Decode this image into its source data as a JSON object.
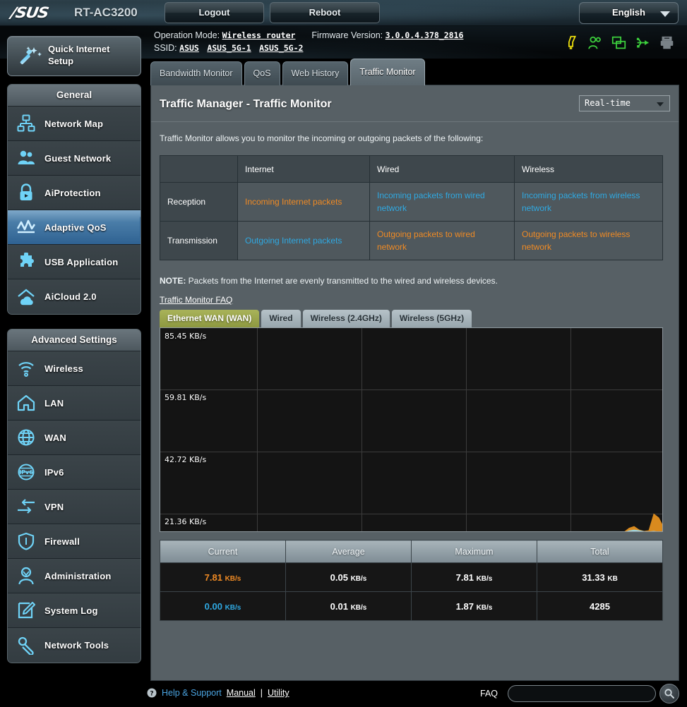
{
  "header": {
    "brand": "/SUS",
    "model": "RT-AC3200",
    "logout_label": "Logout",
    "reboot_label": "Reboot",
    "language": "English"
  },
  "info": {
    "operation_mode_label": "Operation Mode:",
    "operation_mode_value": "Wireless router",
    "firmware_label": "Firmware Version:",
    "firmware_value": "3.0.0.4.378_2816",
    "ssid_label": "SSID:",
    "ssid_values": [
      "ASUS",
      "ASUS_5G-1",
      "ASUS_5G-2"
    ],
    "status_icons": [
      {
        "name": "alert-icon",
        "color": "#f2e30c"
      },
      {
        "name": "guest-user-icon",
        "color": "#3dd13d"
      },
      {
        "name": "network-clients-icon",
        "color": "#3dd13d"
      },
      {
        "name": "usb-icon",
        "color": "#3dd13d"
      },
      {
        "name": "printer-icon",
        "color": "#7a8288"
      }
    ]
  },
  "tabs": [
    {
      "label": "Bandwidth Monitor",
      "active": false
    },
    {
      "label": "QoS",
      "active": false
    },
    {
      "label": "Web History",
      "active": false
    },
    {
      "label": "Traffic Monitor",
      "active": true
    }
  ],
  "sidebar": {
    "quick_setup": "Quick Internet Setup",
    "groups": [
      {
        "title": "General",
        "items": [
          {
            "label": "Network Map",
            "icon": "network-map-icon",
            "active": false
          },
          {
            "label": "Guest Network",
            "icon": "guest-network-icon",
            "active": false
          },
          {
            "label": "AiProtection",
            "icon": "lock-shield-icon",
            "active": false
          },
          {
            "label": "Adaptive QoS",
            "icon": "adaptive-qos-icon",
            "active": true
          },
          {
            "label": "USB Application",
            "icon": "puzzle-icon",
            "active": false
          },
          {
            "label": "AiCloud 2.0",
            "icon": "aicloud-icon",
            "active": false
          }
        ]
      },
      {
        "title": "Advanced Settings",
        "items": [
          {
            "label": "Wireless",
            "icon": "wifi-icon",
            "active": false
          },
          {
            "label": "LAN",
            "icon": "home-icon",
            "active": false
          },
          {
            "label": "WAN",
            "icon": "globe-icon",
            "active": false
          },
          {
            "label": "IPv6",
            "icon": "ipv6-globe-icon",
            "active": false
          },
          {
            "label": "VPN",
            "icon": "vpn-arrows-icon",
            "active": false
          },
          {
            "label": "Firewall",
            "icon": "shield-icon",
            "active": false
          },
          {
            "label": "Administration",
            "icon": "user-icon",
            "active": false
          },
          {
            "label": "System Log",
            "icon": "pencil-note-icon",
            "active": false
          },
          {
            "label": "Network Tools",
            "icon": "wrench-icon",
            "active": false
          }
        ]
      }
    ]
  },
  "main": {
    "title": "Traffic Manager - Traffic Monitor",
    "mode_select": "Real-time",
    "description": "Traffic Monitor allows you to monitor the incoming or outgoing packets of the following:",
    "info_table": {
      "headers": [
        "",
        "Internet",
        "Wired",
        "Wireless"
      ],
      "rows": [
        {
          "label": "Reception",
          "cells": [
            {
              "text": "Incoming Internet packets",
              "color": "orange"
            },
            {
              "text": "Incoming packets from wired network",
              "color": "blue"
            },
            {
              "text": "Incoming packets from wireless network",
              "color": "blue"
            }
          ]
        },
        {
          "label": "Transmission",
          "cells": [
            {
              "text": "Outgoing Internet packets",
              "color": "blue"
            },
            {
              "text": "Outgoing packets to wired network",
              "color": "orange"
            },
            {
              "text": "Outgoing packets to wireless network",
              "color": "orange"
            }
          ]
        }
      ]
    },
    "note_prefix": "NOTE:",
    "note_text": " Packets from the Internet are evenly transmitted to the wired and wireless devices.",
    "faq_link": "Traffic Monitor FAQ",
    "graph_tabs": [
      {
        "label": "Ethernet WAN (WAN)",
        "active": true
      },
      {
        "label": "Wired",
        "active": false
      },
      {
        "label": "Wireless (2.4GHz)",
        "active": false
      },
      {
        "label": "Wireless (5GHz)",
        "active": false
      }
    ],
    "stats_headers": [
      "Current",
      "Average",
      "Maximum",
      "Total"
    ],
    "stats_rows": [
      {
        "color": "orange",
        "cells": [
          {
            "value": "7.81",
            "unit": "KB/s"
          },
          {
            "value": "0.05",
            "unit": "KB/s"
          },
          {
            "value": "7.81",
            "unit": "KB/s"
          },
          {
            "value": "31.33",
            "unit": "KB"
          }
        ]
      },
      {
        "color": "blue",
        "cells": [
          {
            "value": "0.00",
            "unit": "KB/s"
          },
          {
            "value": "0.01",
            "unit": "KB/s"
          },
          {
            "value": "1.87",
            "unit": "KB/s"
          },
          {
            "value": "4285",
            "unit": ""
          }
        ]
      }
    ]
  },
  "chart_data": {
    "type": "area",
    "title": "Ethernet WAN (WAN) real-time traffic",
    "ylabel": "KB/s",
    "xlabel": "",
    "grid": true,
    "legend": "none",
    "ylim": [
      0,
      85.45
    ],
    "y_ticks": [
      "85.45 KB/s",
      "59.81 KB/s",
      "42.72 KB/s",
      "21.36 KB/s"
    ],
    "y_tick_values": [
      85.45,
      59.81,
      42.72,
      21.36
    ],
    "x_gridlines": 4,
    "series": [
      {
        "name": "Reception",
        "color": "#d98a1e",
        "values": [
          0,
          0,
          0,
          0,
          0,
          0,
          0,
          0,
          0,
          0,
          0,
          0,
          0,
          0,
          0,
          0,
          0,
          0,
          0,
          0,
          0,
          0,
          0,
          0,
          0,
          0,
          0,
          0,
          0,
          0,
          0,
          0,
          0,
          0,
          0,
          0,
          0,
          0,
          0,
          0,
          0,
          0,
          0,
          0,
          0,
          0,
          0,
          0,
          0,
          0,
          0,
          0,
          0,
          0,
          0,
          0,
          0,
          0,
          0,
          0,
          0,
          0,
          0,
          0,
          0,
          0,
          0,
          0,
          0,
          0,
          0,
          0,
          0,
          0,
          0,
          0,
          0,
          0,
          0,
          0,
          0,
          0,
          0,
          0,
          0,
          0,
          0,
          0,
          0,
          0,
          0,
          0,
          0,
          0,
          0.3,
          1.9,
          2.6,
          1.2,
          0.6,
          0.9,
          7.81,
          6.2,
          2.1
        ]
      },
      {
        "name": "Transmission",
        "color": "#9fd4dd",
        "values": [
          0,
          0,
          0,
          0,
          0,
          0,
          0,
          0,
          0,
          0,
          0,
          0,
          0,
          0,
          0,
          0,
          0,
          0,
          0,
          0,
          0,
          0,
          0,
          0,
          0,
          0,
          0,
          0,
          0,
          0,
          0,
          0,
          0,
          0,
          0,
          0,
          0,
          0,
          0,
          0,
          0,
          0,
          0,
          0,
          0,
          0,
          0,
          0,
          0,
          0,
          0,
          0,
          0,
          0,
          0,
          0,
          0,
          0,
          0,
          0,
          0,
          0,
          0,
          0,
          0,
          0,
          0,
          0,
          0,
          0,
          0,
          0,
          0,
          0,
          0,
          0,
          0,
          0,
          0,
          0,
          0,
          0,
          0,
          0,
          0,
          0,
          0,
          0,
          0,
          0,
          0,
          0,
          0,
          0,
          0.2,
          0.8,
          1.1,
          0.9,
          0.5,
          0.4,
          0.6,
          0.3,
          0.1
        ]
      }
    ]
  },
  "footer": {
    "help_text": "Help & Support",
    "manual_label": "Manual",
    "divider": "|",
    "utility_label": "Utility",
    "faq_label": "FAQ",
    "faq_placeholder": "",
    "faq_value": ""
  }
}
